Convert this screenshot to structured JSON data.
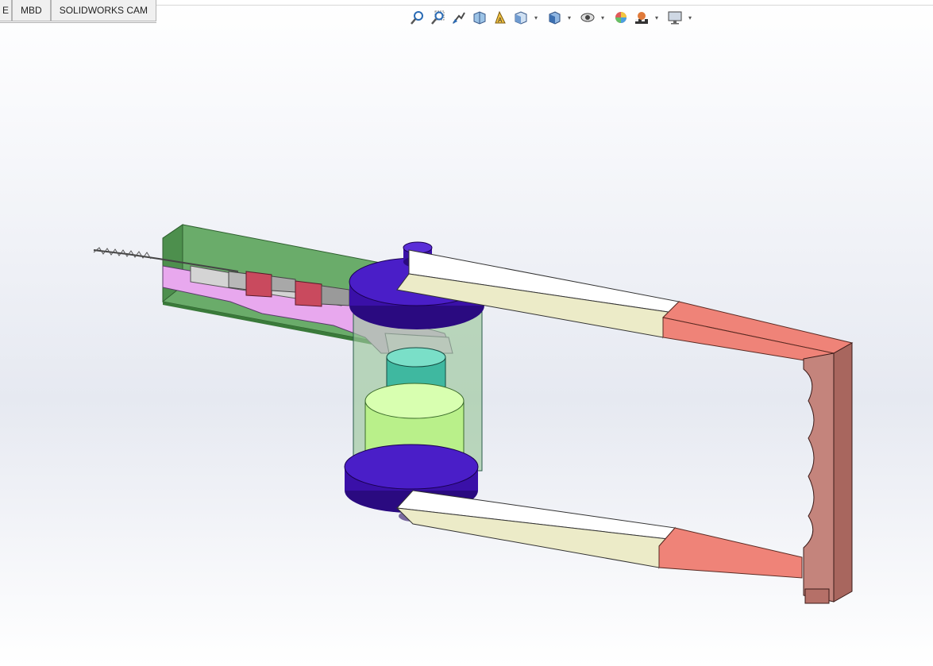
{
  "tabs": [
    {
      "label": "E"
    },
    {
      "label": "MBD"
    },
    {
      "label": "SOLIDWORKS CAM"
    }
  ],
  "heads_up_toolbar": {
    "buttons": [
      {
        "icon": "zoom-to-fit-icon"
      },
      {
        "icon": "zoom-to-area-icon"
      },
      {
        "icon": "previous-view-icon"
      },
      {
        "icon": "section-view-icon"
      },
      {
        "icon": "dynamic-annotation-views-icon"
      },
      {
        "icon": "view-orientation-icon"
      },
      {
        "icon": "display-style-icon"
      },
      {
        "icon": "hide-show-items-icon"
      },
      {
        "icon": "edit-appearance-icon"
      },
      {
        "icon": "apply-scene-icon"
      },
      {
        "icon": "view-settings-icon"
      }
    ]
  },
  "colors": {
    "housing_green": "#6aac6a",
    "purple_disc": "#3a10a8",
    "pink_part": "#e08fe8",
    "red_segments": "#c94a5e",
    "teal_column": "#3fb8a0",
    "light_green_cylinder": "#b9f08a",
    "cream_arm": "#ecebc8",
    "salmon_link": "#ef8378",
    "handle_brown": "#c4847c"
  }
}
